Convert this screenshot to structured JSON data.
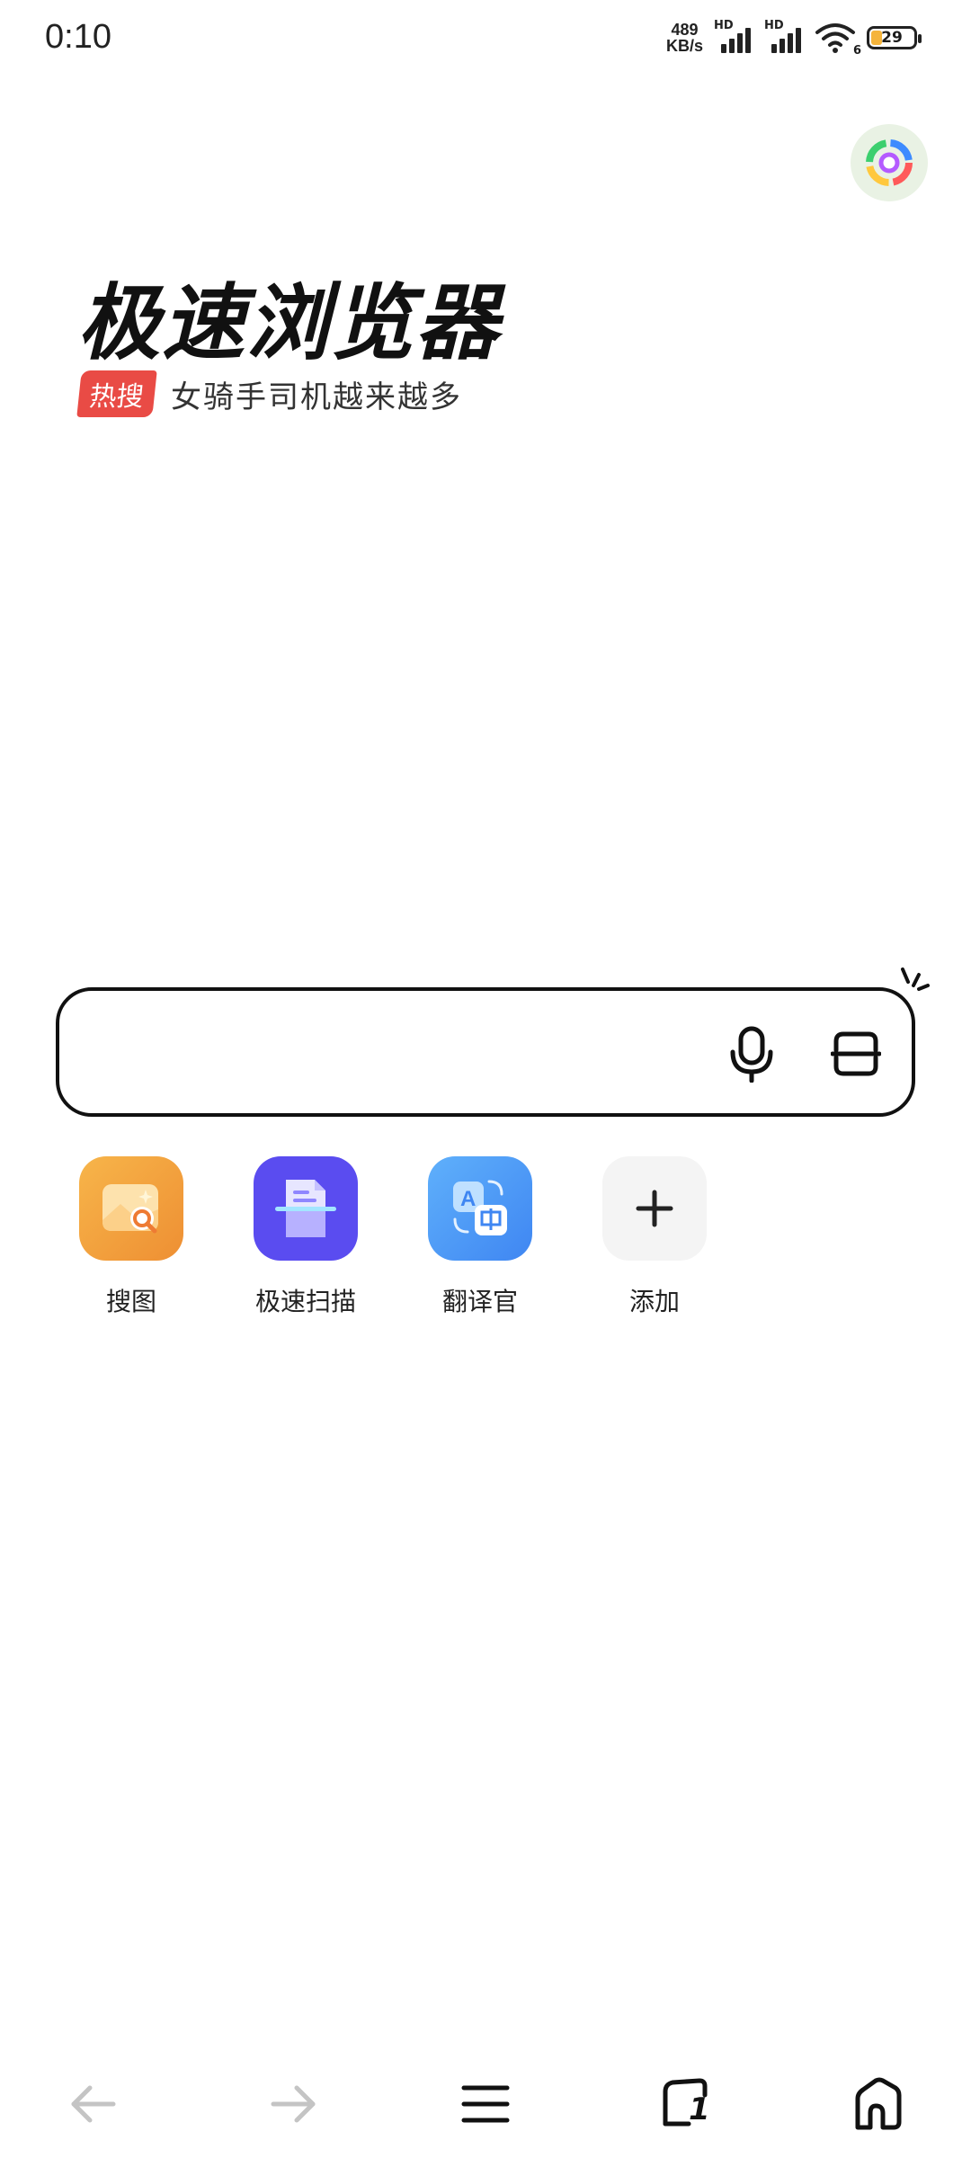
{
  "status_bar": {
    "time": "0:10",
    "net_speed_value": "489",
    "net_speed_unit": "KB/s",
    "signal1_label": "HD",
    "signal2_label": "HD",
    "wifi_label": "6",
    "battery": "29"
  },
  "header": {
    "brand_title": "极速浏览器",
    "hot_tag": "热搜",
    "hot_text": "女骑手司机越来越多"
  },
  "search": {
    "placeholder": ""
  },
  "shortcuts": [
    {
      "label": "搜图",
      "icon": "image-search-icon"
    },
    {
      "label": "极速扫描",
      "icon": "document-scan-icon"
    },
    {
      "label": "翻译官",
      "icon": "translate-icon"
    },
    {
      "label": "添加",
      "icon": "plus-icon"
    }
  ],
  "bottom_nav": {
    "tabs_count": "1"
  },
  "colors": {
    "hot_tag": "#e94b45",
    "scan_purple": "#5a4cf0",
    "translate_blue": "#4f9bf5",
    "image_orange": "#f0a23c",
    "add_gray": "#f4f4f4"
  }
}
